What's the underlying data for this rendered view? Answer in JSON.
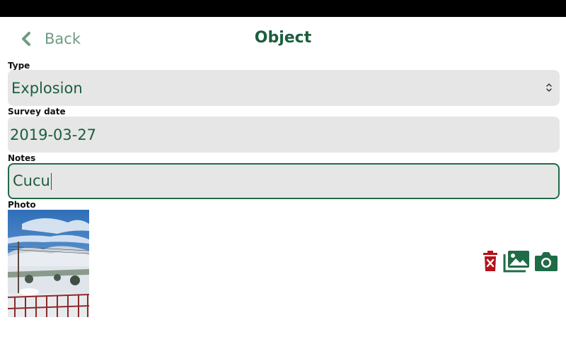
{
  "header": {
    "back_label": "Back",
    "title": "Object"
  },
  "form": {
    "type": {
      "label": "Type",
      "value": "Explosion"
    },
    "survey_date": {
      "label": "Survey date",
      "value": "2019-03-27"
    },
    "notes": {
      "label": "Notes",
      "value": "Cucu"
    },
    "photo": {
      "label": "Photo"
    }
  },
  "icons": {
    "back": "chevron-left-icon",
    "select": "chevron-up-down-icon",
    "delete": "trash-icon",
    "gallery": "image-gallery-icon",
    "camera": "camera-icon"
  },
  "colors": {
    "accent": "#1b5e3e",
    "back_text": "#6f9b83",
    "field_bg": "#e6e6e6",
    "delete": "#b5121b",
    "status_bar": "#000000"
  }
}
